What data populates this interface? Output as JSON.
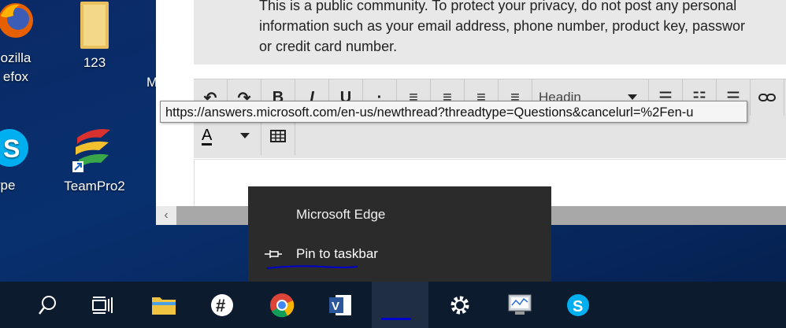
{
  "desktop": {
    "icons": [
      {
        "label": "ozilla\nefox",
        "icon": "firefox-icon"
      },
      {
        "label": "123",
        "icon": "folder-icon"
      },
      {
        "label": "ype",
        "icon": "skype-icon"
      },
      {
        "label": "TeamPro2",
        "icon": "teampro-icon"
      },
      {
        "label": "M",
        "icon": "partial-icon"
      }
    ]
  },
  "browser": {
    "notice": "This is a public community. To protect your privacy, do not post any personal\ninformation such as your email address, phone number, product key, passwor\nor credit card number.",
    "toolbar": {
      "buttons": [
        "↶",
        "↷",
        "B",
        "I",
        "U",
        "·",
        "≡",
        "≡",
        "≡",
        "≡"
      ],
      "heading_select": "Headin",
      "list_buttons": [
        "☰",
        "☷",
        "☰"
      ],
      "link_icon": "link-icon",
      "font_color_label": "A"
    },
    "tooltip_url": "https://answers.microsoft.com/en-us/newthread?threadtype=Questions&cancelurl=%2Fen-u"
  },
  "jumplist": {
    "app_name": "Microsoft Edge",
    "pin_label": "Pin to taskbar"
  },
  "taskbar": {
    "items": [
      "search-icon",
      "task-view-icon",
      "file-explorer-icon",
      "slack-icon",
      "chrome-icon",
      "visio-icon",
      "edge-icon",
      "settings-icon",
      "performance-monitor-icon",
      "skype-icon"
    ]
  },
  "colors": {
    "accent_underline": "#0000cc",
    "taskbar": "#0d1b2e",
    "jumplist": "#2b2b2b"
  }
}
